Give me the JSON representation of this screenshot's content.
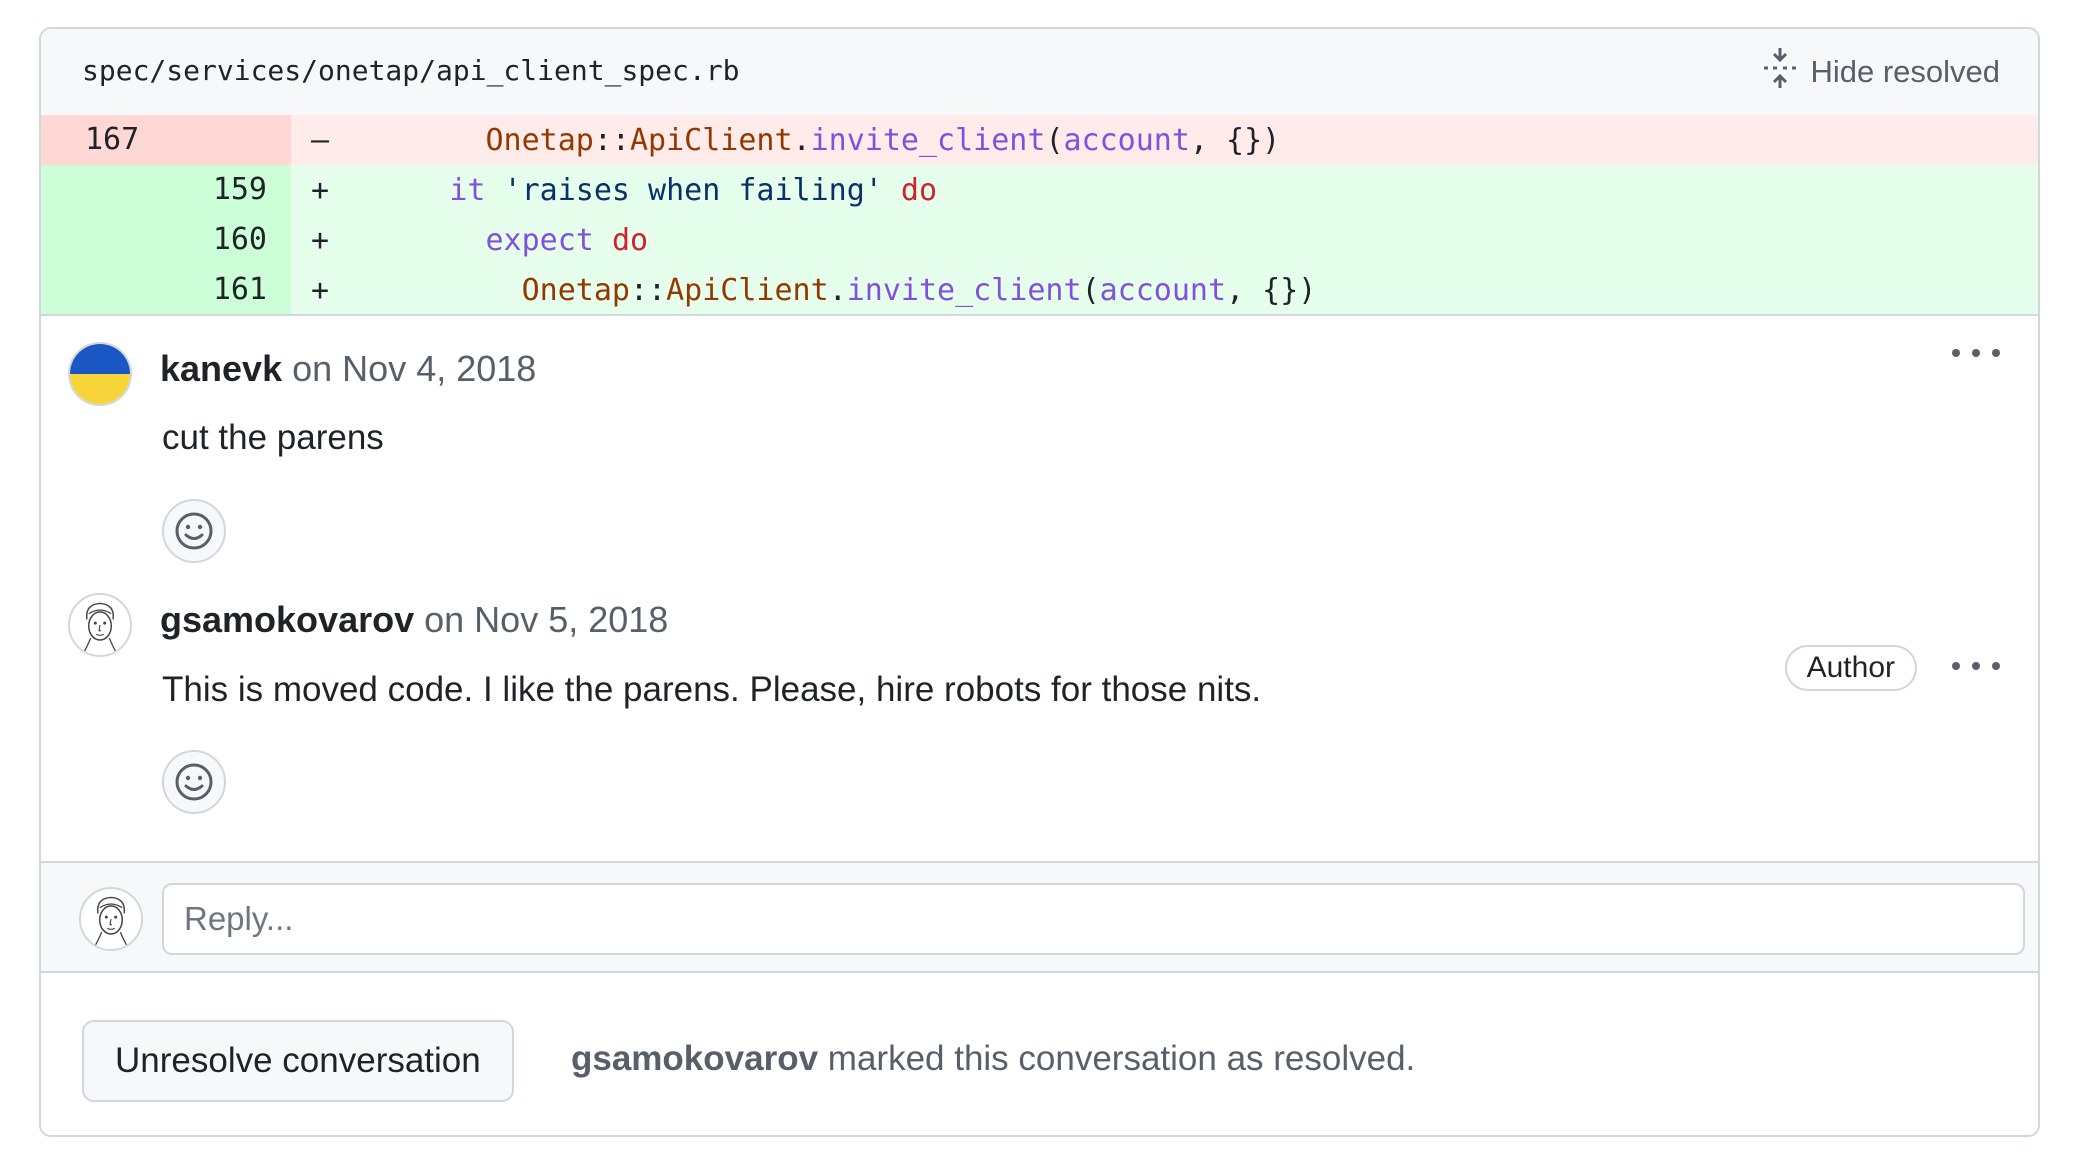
{
  "file": {
    "path": "spec/services/onetap/api_client_spec.rb",
    "hide_resolved_label": "Hide resolved",
    "hide_resolved_icon": "fold-icon"
  },
  "diff": {
    "rows": [
      {
        "type": "del",
        "old_line": "167",
        "new_line": "",
        "marker": "–",
        "tokens": [
          {
            "text": "        ",
            "cls": "t-plain"
          },
          {
            "text": "Onetap",
            "cls": "t-const"
          },
          {
            "text": "::",
            "cls": "t-plain"
          },
          {
            "text": "ApiClient",
            "cls": "t-const"
          },
          {
            "text": ".",
            "cls": "t-plain"
          },
          {
            "text": "invite_client",
            "cls": "t-method"
          },
          {
            "text": "(",
            "cls": "t-plain"
          },
          {
            "text": "account",
            "cls": "t-method"
          },
          {
            "text": ", {})",
            "cls": "t-plain"
          }
        ]
      },
      {
        "type": "add",
        "old_line": "",
        "new_line": "159",
        "marker": "+",
        "tokens": [
          {
            "text": "      ",
            "cls": "t-plain"
          },
          {
            "text": "it",
            "cls": "t-method"
          },
          {
            "text": " ",
            "cls": "t-plain"
          },
          {
            "text": "'raises when failing'",
            "cls": "t-str"
          },
          {
            "text": " ",
            "cls": "t-plain"
          },
          {
            "text": "do",
            "cls": "t-kw"
          }
        ]
      },
      {
        "type": "add",
        "old_line": "",
        "new_line": "160",
        "marker": "+",
        "tokens": [
          {
            "text": "        ",
            "cls": "t-plain"
          },
          {
            "text": "expect",
            "cls": "t-method"
          },
          {
            "text": " ",
            "cls": "t-plain"
          },
          {
            "text": "do",
            "cls": "t-kw"
          }
        ]
      },
      {
        "type": "add",
        "old_line": "",
        "new_line": "161",
        "marker": "+",
        "tokens": [
          {
            "text": "          ",
            "cls": "t-plain"
          },
          {
            "text": "Onetap",
            "cls": "t-const"
          },
          {
            "text": "::",
            "cls": "t-plain"
          },
          {
            "text": "ApiClient",
            "cls": "t-const"
          },
          {
            "text": ".",
            "cls": "t-plain"
          },
          {
            "text": "invite_client",
            "cls": "t-method"
          },
          {
            "text": "(",
            "cls": "t-plain"
          },
          {
            "text": "account",
            "cls": "t-method"
          },
          {
            "text": ", {})",
            "cls": "t-plain"
          }
        ]
      }
    ]
  },
  "comments": [
    {
      "author": "kanevk",
      "date": "on Nov 4, 2018",
      "body": "cut the parens",
      "avatar": "ukraine-flag-avatar",
      "badge": ""
    },
    {
      "author": "gsamokovarov",
      "date": "on Nov 5, 2018",
      "body": "This is moved code. I like the parens. Please, hire robots for those nits.",
      "avatar": "sketch-face-avatar",
      "badge": "Author"
    }
  ],
  "reply": {
    "placeholder": "Reply..."
  },
  "footer": {
    "unresolve_label": "Unresolve conversation",
    "resolved_by": "gsamokovarov",
    "resolved_text": " marked this conversation as resolved."
  },
  "colors": {
    "del_bg": "#ffebe9",
    "del_gutter": "#ffd7d5",
    "add_bg": "#e6ffec",
    "add_gutter": "#ccffd8",
    "border": "#d0d7de",
    "muted": "#57606a"
  }
}
